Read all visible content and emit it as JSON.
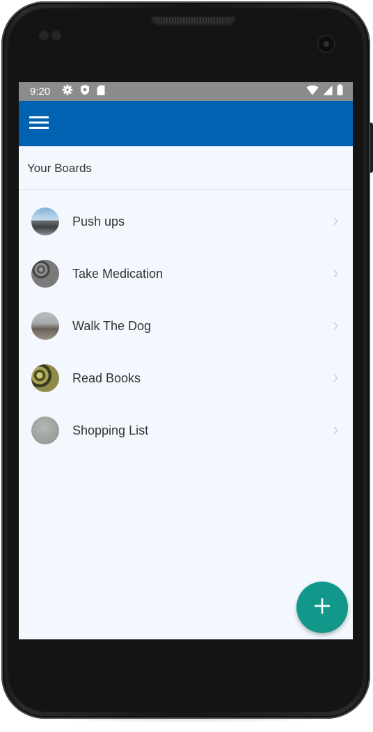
{
  "status_bar": {
    "time": "9:20",
    "left_icons": [
      "settings-icon",
      "shield-icon",
      "sd-card-icon"
    ],
    "right_icons": [
      "wifi-icon",
      "cell-signal-icon",
      "battery-icon"
    ]
  },
  "app_bar": {
    "menu_icon": "hamburger-menu-icon",
    "color": "#0062b1"
  },
  "section": {
    "title": "Your Boards"
  },
  "boards": [
    {
      "label": "Push ups",
      "thumbnail": "photo"
    },
    {
      "label": "Take Medication",
      "thumbnail": "photo"
    },
    {
      "label": "Walk The Dog",
      "thumbnail": "photo"
    },
    {
      "label": "Read Books",
      "thumbnail": "photo"
    },
    {
      "label": "Shopping List",
      "thumbnail": "photo"
    }
  ],
  "fab": {
    "icon": "plus-icon",
    "color": "#12988a"
  }
}
